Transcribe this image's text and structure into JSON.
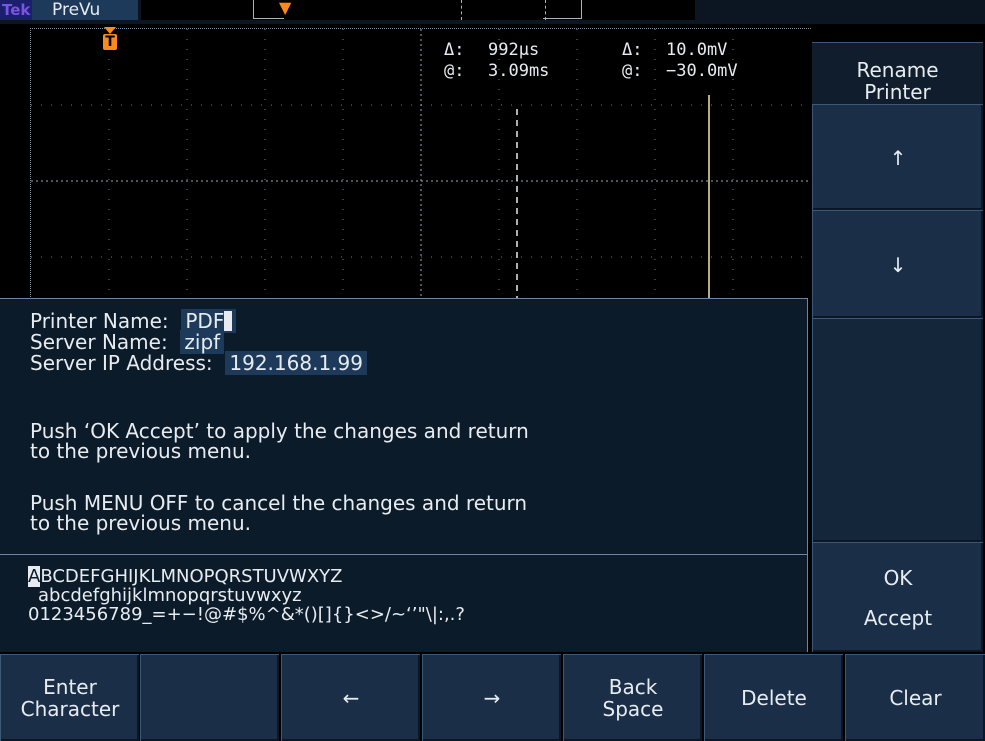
{
  "topbar": {
    "brand": "Tek",
    "mode": "PreVu"
  },
  "readouts": {
    "time": {
      "delta_label": "Δ:",
      "delta_value": "992µs",
      "at_label": "@:",
      "at_value": "3.09ms"
    },
    "volt": {
      "delta_label": "Δ:",
      "delta_value": "10.0mV",
      "at_label": "@:",
      "at_value": "−30.0mV"
    }
  },
  "trigger_marker": "T",
  "right_menu": {
    "title_line1": "Rename",
    "title_line2": "Printer",
    "up": "↑",
    "down": "↓",
    "ok_line1": "OK",
    "ok_line2": "Accept"
  },
  "dialog": {
    "printer_name_label": "Printer Name:",
    "printer_name_value": "PDF",
    "server_name_label": "Server Name:",
    "server_name_value": "zipf",
    "server_ip_label": "Server IP Address:",
    "server_ip_value": "192.168.1.99",
    "msg_accept_1": "Push ‘OK Accept’ to apply the changes and return",
    "msg_accept_2": "to the previous menu.",
    "msg_cancel_1": "Push MENU OFF to cancel the changes and return",
    "msg_cancel_2": "to the previous menu."
  },
  "charset": {
    "selected": "A",
    "upper_rest": "BCDEFGHIJKLMNOPQRSTUVWXYZ",
    "lower": "abcdefghijklmnopqrstuvwxyz",
    "symbols": "0123456789_=+−!@#$%^&*()[]{}<>/~‘’\"\\|:,.?"
  },
  "bottom_menu": {
    "enter_1": "Enter",
    "enter_2": "Character",
    "left": "←",
    "right": "→",
    "back_1": "Back",
    "back_2": "Space",
    "delete": "Delete",
    "clear": "Clear"
  }
}
